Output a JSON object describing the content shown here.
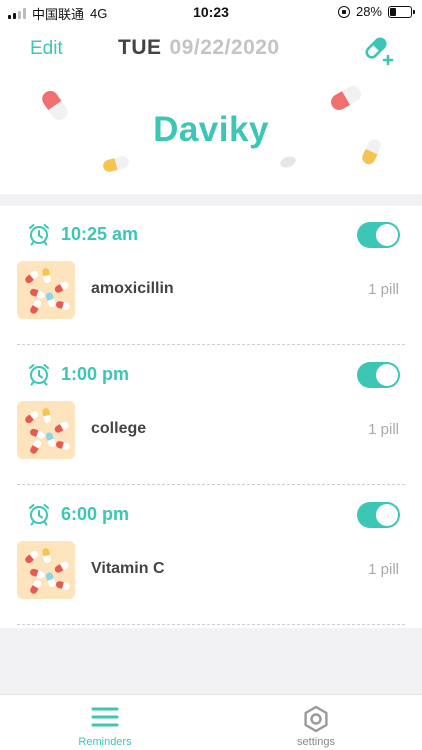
{
  "status_bar": {
    "carrier": "中国联通",
    "network": "4G",
    "time": "10:23",
    "battery": "28%",
    "battery_level": 0.28
  },
  "header": {
    "edit_label": "Edit",
    "day": "TUE",
    "date": "09/22/2020",
    "add_icon": "add-pill-icon",
    "user_name": "Daviky"
  },
  "reminders": [
    {
      "time": "10:25 am",
      "enabled": true,
      "medicine": "amoxicillin",
      "quantity": "1 pill"
    },
    {
      "time": "1:00 pm",
      "enabled": true,
      "medicine": "college",
      "quantity": "1 pill"
    },
    {
      "time": "6:00 pm",
      "enabled": true,
      "medicine": "Vitamin C",
      "quantity": "1 pill"
    }
  ],
  "tabbar": {
    "reminders_label": "Reminders",
    "settings_label": "settings"
  },
  "colors": {
    "accent": "#3cc6b5",
    "thumb_bg": "#fde4bc",
    "muted": "#a9a9a9"
  }
}
